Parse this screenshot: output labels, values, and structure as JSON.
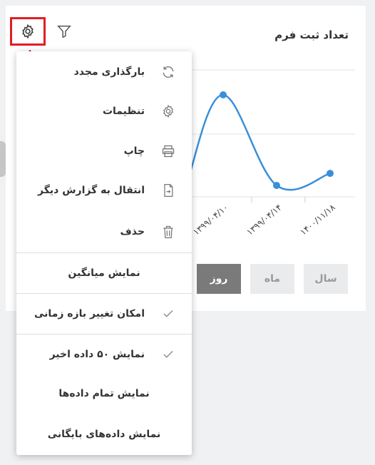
{
  "card": {
    "title": "تعداد ثبت فرم"
  },
  "icons": {
    "settings": "gear-icon",
    "filter": "filter-icon",
    "annotation": "red-arrow-up-icon"
  },
  "colors": {
    "accent": "#3a8fd9",
    "highlight": "#e11d25",
    "active_button": "#7a7a7a",
    "inactive_button": "#e9ebed"
  },
  "chart_data": {
    "type": "line",
    "x": [
      "۱۳۹۹/۰۴/۱۰",
      "۱۳۹۹/۰۴/۱۴",
      "۱۴۰۰/۱۱/۱۸"
    ],
    "series": [
      {
        "values": [
          100,
          10,
          22
        ]
      }
    ],
    "grid": true
  },
  "range_buttons": [
    {
      "label": "سال",
      "active": false
    },
    {
      "label": "ماه",
      "active": false
    },
    {
      "label": "روز",
      "active": true
    }
  ],
  "menu": {
    "items": [
      {
        "label": "بارگذاری مجدد",
        "icon": "refresh-icon"
      },
      {
        "label": "تنظیمات",
        "icon": "gear-icon"
      },
      {
        "label": "چاپ",
        "icon": "printer-icon"
      },
      {
        "label": "انتقال به گزارش دیگر",
        "icon": "file-export-icon"
      },
      {
        "label": "حذف",
        "icon": "trash-icon"
      }
    ],
    "show_average": "نمایش میانگین",
    "allow_range_change": {
      "label": "امکان تغییر بازه زمانی",
      "checked": true
    },
    "show_last_50": {
      "label": "نمایش ۵۰ داده اخیر",
      "checked": true
    },
    "show_all": "نمایش تمام داده‌ها",
    "show_archived": "نمایش داده‌های بایگانی"
  }
}
